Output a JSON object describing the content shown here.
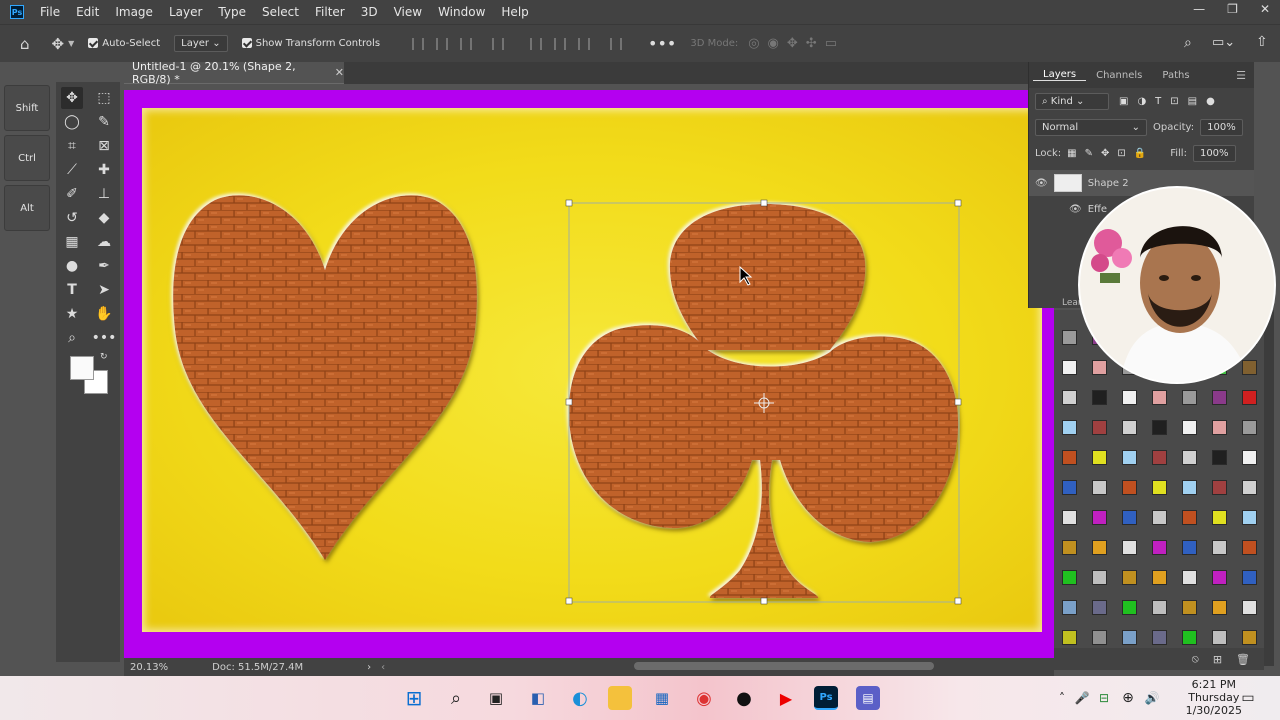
{
  "app": {
    "logo_text": "Ps"
  },
  "menu": [
    "File",
    "Edit",
    "Image",
    "Layer",
    "Type",
    "Select",
    "Filter",
    "3D",
    "View",
    "Window",
    "Help"
  ],
  "options_bar": {
    "auto_select_label": "Auto-Select",
    "auto_select_target": "Layer",
    "show_transform_label": "Show Transform Controls",
    "mode_3d_label": "3D Mode:"
  },
  "shortcut_keys": [
    "Shift",
    "Ctrl",
    "Alt"
  ],
  "document": {
    "tab_title": "Untitled-1 @ 20.1% (Shape 2, RGB/8) *",
    "zoom": "20.13%",
    "doc_size": "Doc: 51.5M/27.4M"
  },
  "layers_panel": {
    "tabs": [
      "Layers",
      "Channels",
      "Paths"
    ],
    "filter_kind": "Kind",
    "blend_mode": "Normal",
    "opacity_label": "Opacity:",
    "opacity_value": "100%",
    "lock_label": "Lock:",
    "fill_label": "Fill:",
    "fill_value": "100%",
    "layer_name": "Shape 2",
    "effects_label": "Effe",
    "library_label": "Lear"
  },
  "taskbar": {
    "time": "6:21 PM",
    "day": "Thursday",
    "date": "1/30/2025"
  },
  "colors": {
    "canvas_border": "#b400f0",
    "canvas_fill": "#f2dc1a",
    "brick": "#c0622a"
  }
}
